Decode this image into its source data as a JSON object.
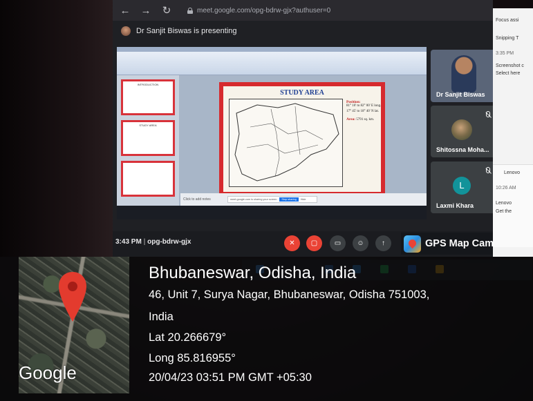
{
  "browser": {
    "url": "meet.google.com/opg-bdrw-gjx?authuser=0"
  },
  "meet": {
    "presenting_text": "Dr Sanjit Biswas is presenting",
    "time": "3:43 PM",
    "meeting_code": "opg-bdrw-gjx",
    "participants": [
      {
        "name": "Dr Sanjit Biswas",
        "avatar": "video"
      },
      {
        "name": "Shitossna Moha...",
        "avatar": "photo",
        "muted": true
      },
      {
        "name": "Laxmi Khara",
        "avatar": "L",
        "avatar_color": "#12939a",
        "muted": true
      }
    ],
    "controls": [
      "mic-off-icon",
      "camera-off-icon",
      "captions-icon",
      "emoji-icon",
      "present-icon"
    ]
  },
  "slide": {
    "title": "STUDY AREA",
    "position_label": "Position:",
    "lon": "81° 10' to 82° 00' E long.",
    "lat": "17° 45' to 18° 40' N lat.",
    "area_label": "Area:",
    "area_value": "5791 sq. km.",
    "notes_placeholder": "Click to add notes",
    "share_toast": "meet.google.com is sharing your screen.",
    "stop_sharing": "Stop sharing",
    "hide": "Hide"
  },
  "notifications": {
    "focus": "Focus assi",
    "snipping": "Snipping T",
    "time1": "3:35 PM",
    "text1a": "Screenshot c",
    "text1b": "Select here",
    "lenovo_app": "Lenovo",
    "time2": "10:26 AM",
    "text2a": "Lenovo",
    "text2b": "Get the"
  },
  "gps_camera": {
    "app_name": "GPS Map Camera",
    "map_logo": "Google",
    "place": "Bhubaneswar, Odisha, India",
    "address_line1": "46, Unit 7, Surya Nagar, Bhubaneswar, Odisha 751003,",
    "address_line2": "India",
    "latitude": "Lat 20.266679°",
    "longitude": "Long 85.816955°",
    "datetime": "20/04/23 03:51 PM GMT +05:30"
  },
  "colors": {
    "meet_red": "#ea4335",
    "slide_border": "#d62a2e",
    "slide_title": "#1f3f93"
  }
}
